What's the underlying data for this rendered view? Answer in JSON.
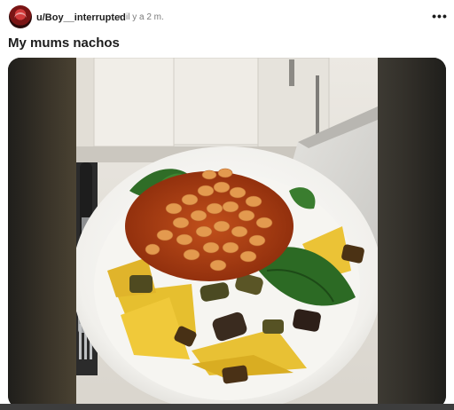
{
  "post": {
    "username": "u/Boy__interrupted",
    "separator": "•",
    "timestamp": "il y a 2 m.",
    "more_label": "•••",
    "title": "My mums nachos",
    "image_alt": "Plate of nachos topped with baked beans, spinach and roasted vegetables"
  },
  "icons": {
    "avatar": "user-avatar",
    "more": "more-options-icon"
  },
  "colors": {
    "text": "#1c1c1c",
    "meta": "#7c7c7c",
    "media_bg": "#2c2a26"
  }
}
